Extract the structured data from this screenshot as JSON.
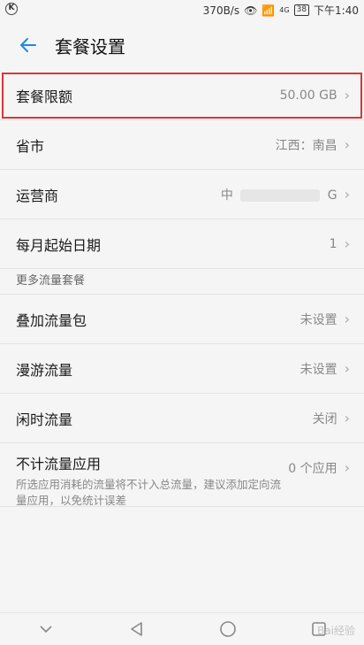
{
  "status_bar": {
    "network_speed": "370B/s",
    "signal_label": "4G",
    "battery": "38",
    "time": "下午1:40"
  },
  "header": {
    "title": "套餐设置"
  },
  "rows": [
    {
      "label": "套餐限额",
      "value": "50.00 GB"
    },
    {
      "label": "省市",
      "value": "江西：南昌"
    },
    {
      "label": "运营商",
      "value_prefix": "中",
      "value_suffix": "G"
    },
    {
      "label": "每月起始日期",
      "value": "1"
    }
  ],
  "section_more": "更多流量套餐",
  "more_rows": [
    {
      "label": "叠加流量包",
      "value": "未设置"
    },
    {
      "label": "漫游流量",
      "value": "未设置"
    },
    {
      "label": "闲时流量",
      "value": "关闭"
    }
  ],
  "exempt": {
    "label": "不计流量应用",
    "desc": "所选应用消耗的流量将不计入总流量，建议添加定向流量应用，以免统计误差",
    "value": "0 个应用"
  },
  "watermark": "Bai经验",
  "colors": {
    "accent": "#1e88e5",
    "highlight": "#d93636"
  }
}
